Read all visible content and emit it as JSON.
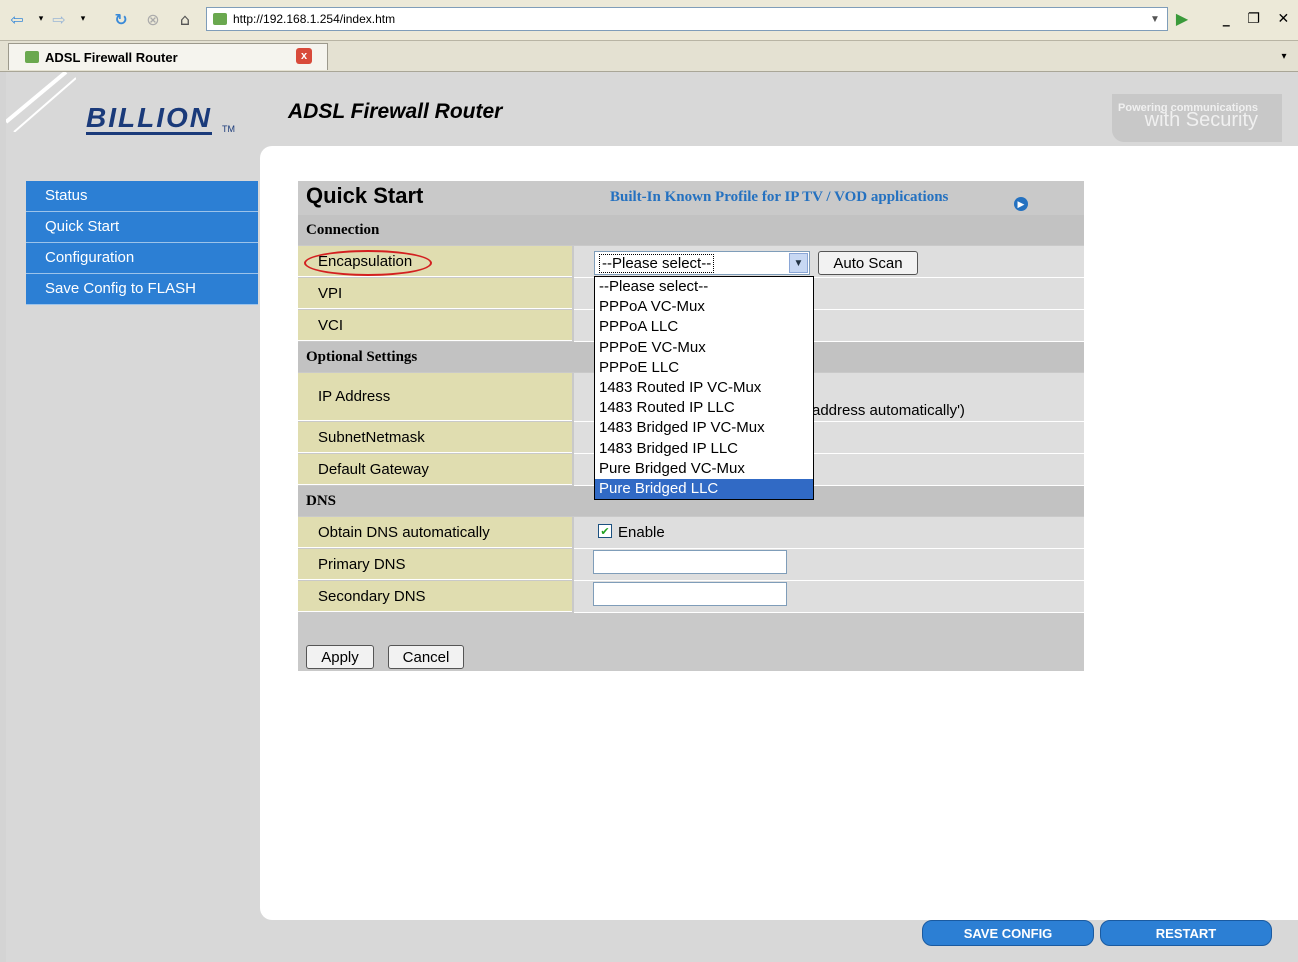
{
  "browser": {
    "url": "http://192.168.1.254/index.htm",
    "tab_title": "ADSL Firewall Router"
  },
  "header": {
    "logo": "BILLION",
    "logo_tm": "TM",
    "product_title": "ADSL Firewall Router",
    "slogan_line1": "Powering communications",
    "slogan_line2": "with Security"
  },
  "sidebar": {
    "items": [
      "Status",
      "Quick Start",
      "Configuration",
      "Save Config to FLASH"
    ]
  },
  "quick_start": {
    "title": "Quick Start",
    "profile_link": "Built-In Known Profile for IP TV / VOD applications",
    "sections": {
      "connection": "Connection",
      "optional": "Optional Settings",
      "dns": "DNS"
    },
    "labels": {
      "encapsulation": "Encapsulation",
      "vpi": "VPI",
      "vci": "VCI",
      "ip_address": "IP Address",
      "subnet": "SubnetNetmask",
      "gateway": "Default Gateway",
      "obtain_dns": "Obtain DNS automatically",
      "primary_dns": "Primary DNS",
      "secondary_dns": "Secondary DNS"
    },
    "encapsulation_selected": "--Please select--",
    "encapsulation_options": [
      "--Please select--",
      "PPPoA VC-Mux",
      "PPPoA LLC",
      "PPPoE VC-Mux",
      "PPPoE LLC",
      "1483 Routed IP VC-Mux",
      "1483 Routed IP LLC",
      "1483 Bridged IP VC-Mux",
      "1483 Bridged IP LLC",
      "Pure Bridged VC-Mux",
      "Pure Bridged LLC"
    ],
    "highlighted_option": "Pure Bridged LLC",
    "auto_scan": "Auto Scan",
    "ip_hint_partial": "address automatically')",
    "dns_enable_label": "Enable",
    "dns_enabled": true,
    "apply": "Apply",
    "cancel": "Cancel"
  },
  "bottom": {
    "save_config": "SAVE CONFIG",
    "restart": "RESTART"
  }
}
